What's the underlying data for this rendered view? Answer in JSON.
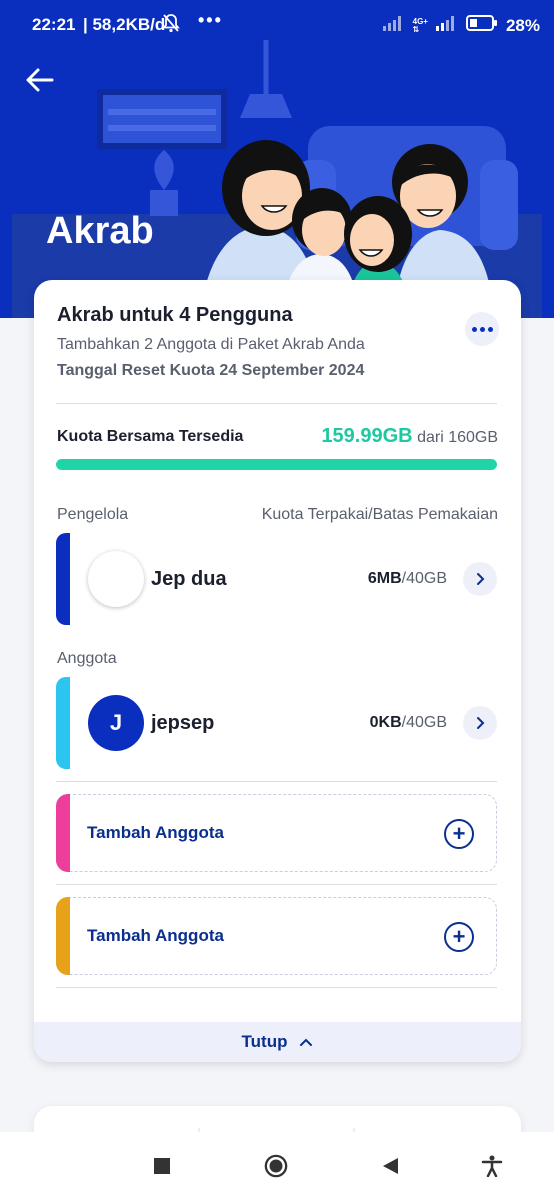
{
  "status_bar": {
    "time": "22:21",
    "network_speed": "| 58,2KB/d",
    "dots": "•••",
    "network_type": "4G+",
    "battery": "28%",
    "icons": [
      "mute-bell-icon",
      "signal-icon",
      "battery-icon"
    ]
  },
  "header": {
    "back_icon": "arrow-left-icon",
    "title": "Akrab"
  },
  "package": {
    "title": "Akrab untuk 4 Pengguna",
    "subtitle": "Tambahkan 2 Anggota di Paket Akrab Anda",
    "reset_date": "Tanggal Reset Kuota 24 September 2024",
    "more_icon": "more-horizontal-icon"
  },
  "quota": {
    "label": "Kuota Bersama Tersedia",
    "available": "159.99GB",
    "total_text": "dari 160GB",
    "fraction_available": 0.9999
  },
  "sections": {
    "manager_label": "Pengelola",
    "usage_header": "Kuota Terpakai/Batas Pemakaian",
    "member_label": "Anggota"
  },
  "manager": {
    "name": "Jep dua",
    "avatar_initial": "",
    "used": "6MB",
    "limit": "/40GB",
    "accent_color": "#0a2fbf"
  },
  "member": {
    "name": "jepsep",
    "avatar_initial": "J",
    "used": "0KB",
    "limit": "/40GB",
    "accent_color": "#2bc5f0"
  },
  "add_slots": [
    {
      "label": "Tambah Anggota",
      "accent_color": "#ec3e9a"
    },
    {
      "label": "Tambah Anggota",
      "accent_color": "#e8a21a"
    }
  ],
  "close_label": "Tutup",
  "colors": {
    "brand_blue": "#0a2fbf",
    "quota_green": "#1ec8a0"
  }
}
